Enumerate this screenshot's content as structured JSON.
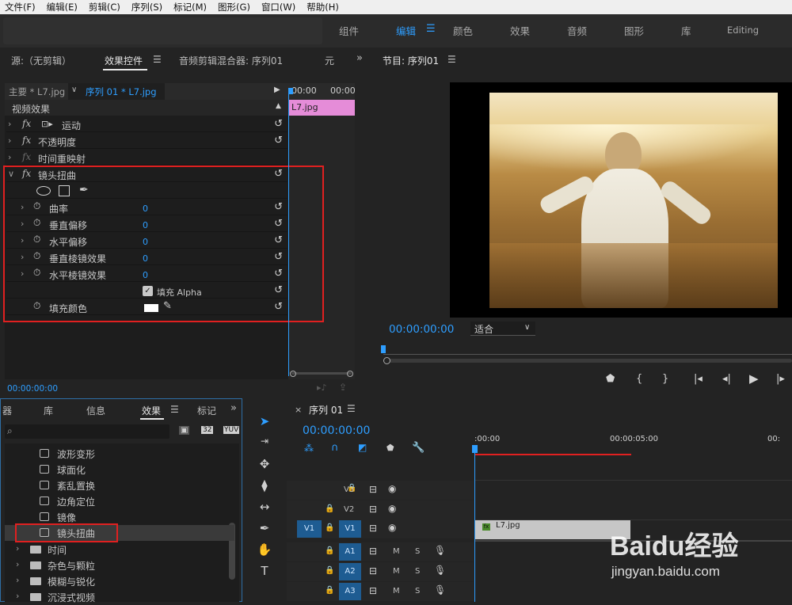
{
  "menu": [
    "文件(F)",
    "编辑(E)",
    "剪辑(C)",
    "序列(S)",
    "标记(M)",
    "图形(G)",
    "窗口(W)",
    "帮助(H)"
  ],
  "workspaces": [
    "组件",
    "编辑",
    "颜色",
    "效果",
    "音频",
    "图形",
    "库",
    "Editing"
  ],
  "effect_controls": {
    "tabs": [
      "源:（无剪辑）",
      "效果控件",
      "音频剪辑混合器: 序列01",
      "元"
    ],
    "master_label": "主要 * L7.jpg",
    "sequence_label": "序列 01 * L7.jpg",
    "ruler_times": [
      "00:00",
      "00:00"
    ],
    "clip_label": "L7.jpg",
    "section_title": "视频效果",
    "rows": {
      "motion": "运动",
      "opacity": "不透明度",
      "time_remap": "时间重映射",
      "lens_distortion": "镜头扭曲",
      "curvature": "曲率",
      "vertical_decenter": "垂直偏移",
      "horizontal_decenter": "水平偏移",
      "vertical_prism": "垂直棱镜效果",
      "horizontal_prism": "水平棱镜效果",
      "fill_alpha": "填充 Alpha",
      "fill_color": "填充颜色"
    },
    "values": {
      "curvature": "0",
      "vertical_decenter": "0",
      "horizontal_decenter": "0",
      "vertical_prism": "0",
      "horizontal_prism": "0"
    },
    "fx_glyph": "fx",
    "timecode": "00:00:00:00"
  },
  "program": {
    "title": "节目: 序列01",
    "timecode": "00:00:00:00",
    "fit": "适合"
  },
  "effects_panel": {
    "tabs": [
      "器",
      "库",
      "信息",
      "效果",
      "标记"
    ],
    "items": [
      "波形变形",
      "球面化",
      "紊乱置换",
      "边角定位",
      "镜像",
      "镜头扭曲"
    ],
    "folders": [
      "时间",
      "杂色与颗粒",
      "模糊与锐化",
      "沉浸式视频"
    ]
  },
  "timeline": {
    "title": "序列 01",
    "timecode": "00:00:00:00",
    "ruler": [
      ":00:00",
      "00:00:05:00",
      "00:"
    ],
    "tracks_v": [
      "V3",
      "V2",
      "V1"
    ],
    "tracks_a": [
      "A1",
      "A2",
      "A3"
    ],
    "source_v": "V1",
    "clip": "L7.jpg",
    "mute": "M",
    "solo": "S"
  },
  "watermark": {
    "brand": "Baidu经验",
    "url": "jingyan.baidu.com"
  }
}
